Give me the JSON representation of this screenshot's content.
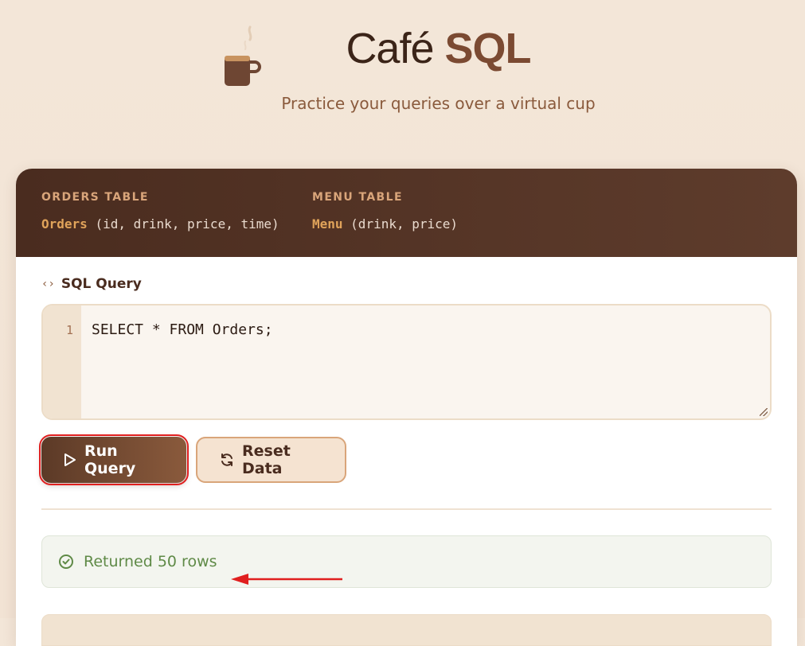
{
  "header": {
    "title_thin": "Café",
    "title_bold": "SQL",
    "subtitle": "Practice your queries over a virtual cup"
  },
  "schema": {
    "orders": {
      "heading": "ORDERS TABLE",
      "name": "Orders",
      "columns": "(id, drink, price, time)"
    },
    "menu": {
      "heading": "MENU TABLE",
      "name": "Menu",
      "columns": "(drink, price)"
    }
  },
  "query": {
    "label": "SQL Query",
    "line_number": "1",
    "code": "SELECT * FROM Orders;"
  },
  "buttons": {
    "run_label": "Run Query",
    "reset_label": "Reset Data"
  },
  "result": {
    "message": "Returned 50 rows"
  },
  "colors": {
    "accent": "#8a5a3c",
    "dark": "#4a2c1f",
    "success": "#5f8a47",
    "highlight": "#e01f1f"
  },
  "icons": [
    "coffee-cup-icon",
    "code-icon",
    "play-icon",
    "refresh-icon",
    "check-circle-icon",
    "arrow-left-icon"
  ]
}
